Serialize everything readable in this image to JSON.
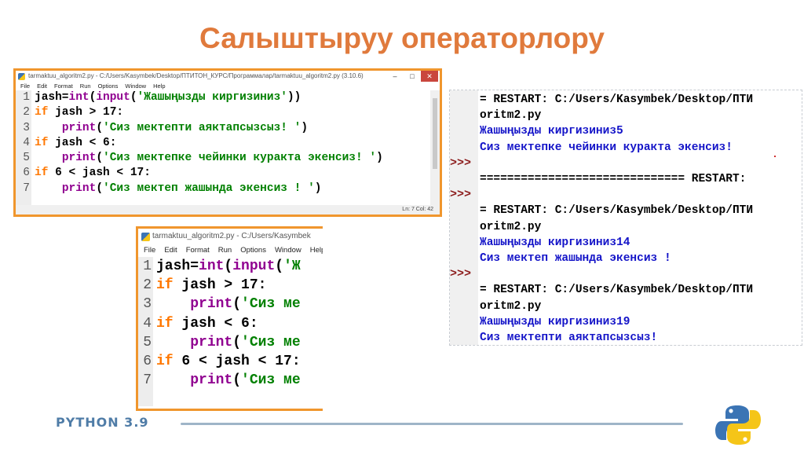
{
  "slide": {
    "title": "Салыштыруу операторлору",
    "footer_text": "PYTHON 3.9"
  },
  "colors": {
    "title": "#e07a3c",
    "window_border": "#f0962d",
    "keyword": "#ff7700",
    "builtin": "#900090",
    "string": "#008000",
    "shell_output": "#1414c8",
    "prompt": "#8b1a1a"
  },
  "editor1": {
    "title": "tarmaktuu_algoritm2.py - C:/Users/Kasymbek/Desktop/ПТИТОН_КУРС/Программалар/tarmaktuu_algoritm2.py (3.10.6)",
    "controls": [
      "–",
      "□",
      "✕"
    ],
    "menu": [
      "File",
      "Edit",
      "Format",
      "Run",
      "Options",
      "Window",
      "Help"
    ],
    "line_numbers": [
      "1",
      "2",
      "3",
      "4",
      "5",
      "6",
      "7"
    ],
    "status": "Ln: 7    Col: 42",
    "lines": [
      [
        {
          "t": "jash="
        },
        {
          "t": "int",
          "c": "b"
        },
        {
          "t": "("
        },
        {
          "t": "input",
          "c": "b"
        },
        {
          "t": "("
        },
        {
          "t": "'Жашыңызды киргизиниз'",
          "c": "s"
        },
        {
          "t": "))"
        }
      ],
      [
        {
          "t": "if",
          "c": "k"
        },
        {
          "t": " jash > 17:"
        }
      ],
      [
        {
          "t": "    "
        },
        {
          "t": "print",
          "c": "b"
        },
        {
          "t": "("
        },
        {
          "t": "'Сиз мектепти аяктапсызсыз! '",
          "c": "s"
        },
        {
          "t": ")"
        }
      ],
      [
        {
          "t": "if",
          "c": "k"
        },
        {
          "t": " jash < 6:"
        }
      ],
      [
        {
          "t": "    "
        },
        {
          "t": "print",
          "c": "b"
        },
        {
          "t": "("
        },
        {
          "t": "'Сиз мектепке чейинки куракта экенсиз! '",
          "c": "s"
        },
        {
          "t": ")"
        }
      ],
      [
        {
          "t": "if",
          "c": "k"
        },
        {
          "t": " 6 < jash < 17:"
        }
      ],
      [
        {
          "t": "    "
        },
        {
          "t": "print",
          "c": "b"
        },
        {
          "t": "("
        },
        {
          "t": "'Сиз мектеп жашында экенсиз ! '",
          "c": "s"
        },
        {
          "t": ")"
        }
      ]
    ]
  },
  "editor2": {
    "title": "tarmaktuu_algoritm2.py - C:/Users/Kasymbek",
    "menu": [
      "File",
      "Edit",
      "Format",
      "Run",
      "Options",
      "Window",
      "Help"
    ],
    "line_numbers": [
      "1",
      "2",
      "3",
      "4",
      "5",
      "6",
      "7"
    ],
    "lines": [
      [
        {
          "t": "jash="
        },
        {
          "t": "int",
          "c": "b"
        },
        {
          "t": "("
        },
        {
          "t": "input",
          "c": "b"
        },
        {
          "t": "("
        },
        {
          "t": "'Ж",
          "c": "s"
        }
      ],
      [
        {
          "t": "if",
          "c": "k"
        },
        {
          "t": " jash > 17:"
        }
      ],
      [
        {
          "t": "    "
        },
        {
          "t": "print",
          "c": "b"
        },
        {
          "t": "("
        },
        {
          "t": "'Сиз ме",
          "c": "s"
        }
      ],
      [
        {
          "t": "if",
          "c": "k"
        },
        {
          "t": " jash < 6:"
        }
      ],
      [
        {
          "t": "    "
        },
        {
          "t": "print",
          "c": "b"
        },
        {
          "t": "("
        },
        {
          "t": "'Сиз ме",
          "c": "s"
        }
      ],
      [
        {
          "t": "if",
          "c": "k"
        },
        {
          "t": " 6 < jash < 17:"
        }
      ],
      [
        {
          "t": "    "
        },
        {
          "t": "print",
          "c": "b"
        },
        {
          "t": "("
        },
        {
          "t": "'Сиз ме",
          "c": "s"
        }
      ]
    ]
  },
  "shell": {
    "prompt": ">>>",
    "lines": [
      {
        "text": "= RESTART: C:/Users/Kasymbek/Desktop/ПТИ",
        "c": "out-black"
      },
      {
        "text": "oritm2.py",
        "c": "out-black"
      },
      {
        "text": "Жашыңызды киргизиниз5",
        "c": "out-blue"
      },
      {
        "text": "Сиз мектепке чейинки куракта экенсиз!",
        "c": "out-blue"
      },
      {
        "text": "",
        "c": "out-black"
      },
      {
        "text": "============================== RESTART:",
        "c": "out-black"
      },
      {
        "text": "",
        "c": "out-black"
      },
      {
        "text": "= RESTART: C:/Users/Kasymbek/Desktop/ПТИ",
        "c": "out-black"
      },
      {
        "text": "oritm2.py",
        "c": "out-black"
      },
      {
        "text": "Жашыңызды киргизиниз14",
        "c": "out-blue"
      },
      {
        "text": "Сиз мектеп жашында экенсиз !",
        "c": "out-blue"
      },
      {
        "text": "",
        "c": "out-black"
      },
      {
        "text": "= RESTART: C:/Users/Kasymbek/Desktop/ПТИ",
        "c": "out-black"
      },
      {
        "text": "oritm2.py",
        "c": "out-black"
      },
      {
        "text": "Жашыңызды киргизиниз19",
        "c": "out-blue"
      },
      {
        "text": "Сиз мектепти аяктапсызсыз!",
        "c": "out-blue"
      }
    ]
  }
}
